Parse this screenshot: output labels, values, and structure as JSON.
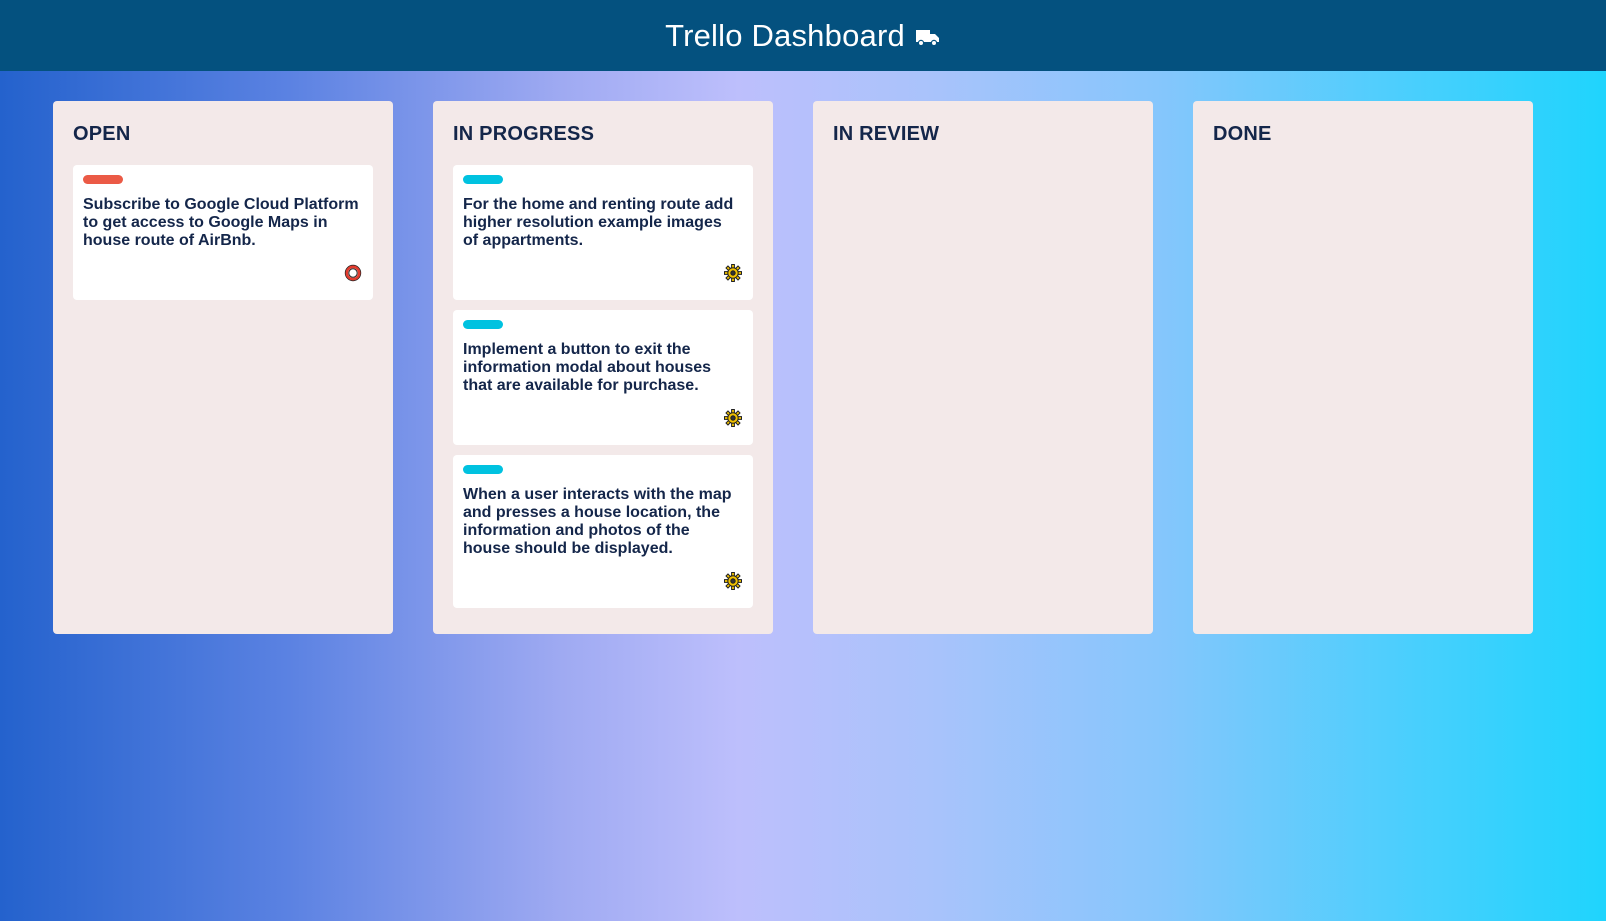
{
  "header": {
    "title": "Trello Dashboard",
    "icon": "truck-icon"
  },
  "colors": {
    "header_bg": "#04517f",
    "column_bg": "#f3e9e9",
    "open_label": "#eb5a46",
    "progress_label": "#00c2e0",
    "text": "#14264a"
  },
  "columns": [
    {
      "title": "OPEN",
      "cards": [
        {
          "label_color": "#eb5a46",
          "text": "Subscribe to Google Cloud Platform to get access to Google Maps in house route of AirBnb.",
          "icon": "ring-icon"
        }
      ]
    },
    {
      "title": "IN PROGRESS",
      "cards": [
        {
          "label_color": "#00c2e0",
          "text": "For the home and renting route add higher resolution example images of appartments.",
          "icon": "gear-icon"
        },
        {
          "label_color": "#00c2e0",
          "text": "Implement a button to exit the information modal about houses that are available for purchase.",
          "icon": "gear-icon"
        },
        {
          "label_color": "#00c2e0",
          "text": "When a user interacts with the map and presses a house location, the information and photos of the house should be displayed.",
          "icon": "gear-icon"
        }
      ]
    },
    {
      "title": "IN REVIEW",
      "cards": []
    },
    {
      "title": "DONE",
      "cards": []
    }
  ]
}
